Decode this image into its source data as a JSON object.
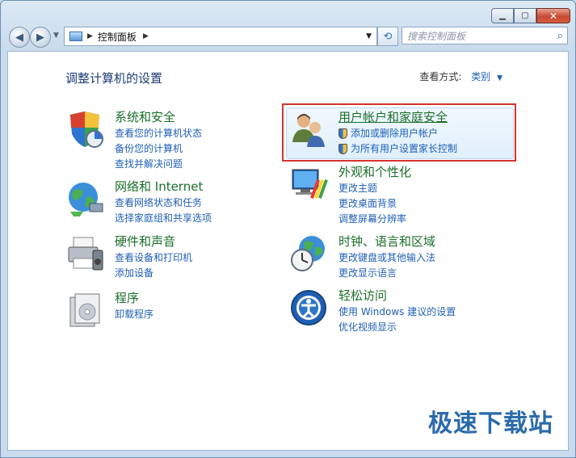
{
  "window": {
    "caption": {
      "minimize": "▁",
      "maximize": "▢",
      "close": "✕"
    }
  },
  "nav": {
    "back_glyph": "◀",
    "forward_glyph": "▶",
    "breadcrumb": "控制面板",
    "search_placeholder": "搜索控制面板",
    "refresh_glyph": "⟲"
  },
  "header": {
    "title": "调整计算机的设置",
    "view_by_label": "查看方式:",
    "view_by_value": "类别"
  },
  "categories": [
    {
      "title": "系统和安全",
      "links": [
        "查看您的计算机状态",
        "备份您的计算机",
        "查找并解决问题"
      ]
    },
    {
      "title": "网络和 Internet",
      "links": [
        "查看网络状态和任务",
        "选择家庭组和共享选项"
      ]
    },
    {
      "title": "硬件和声音",
      "links": [
        "查看设备和打印机",
        "添加设备"
      ]
    },
    {
      "title": "程序",
      "links": [
        "卸载程序"
      ]
    },
    {
      "title": "用户帐户和家庭安全",
      "links": [
        "添加或删除用户帐户",
        "为所有用户设置家长控制"
      ]
    },
    {
      "title": "外观和个性化",
      "links": [
        "更改主题",
        "更改桌面背景",
        "调整屏幕分辨率"
      ]
    },
    {
      "title": "时钟、语言和区域",
      "links": [
        "更改键盘或其他输入法",
        "更改显示语言"
      ]
    },
    {
      "title": "轻松访问",
      "links": [
        "使用 Windows 建议的设置",
        "优化视频显示"
      ]
    }
  ],
  "watermark": "极速下载站",
  "colors": {
    "link": "#1f5fb5",
    "category_title": "#1a6e2a",
    "highlight_border": "#d6332f"
  }
}
